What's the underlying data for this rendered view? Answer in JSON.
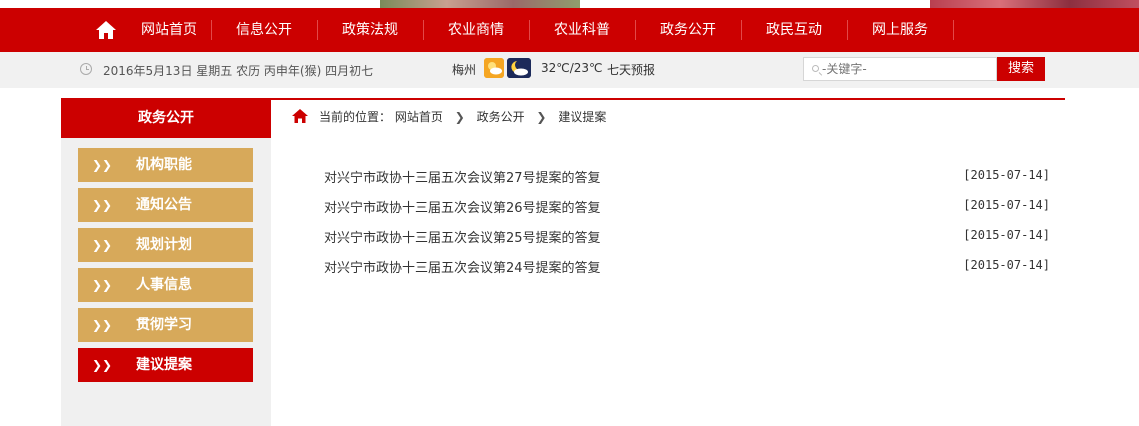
{
  "nav": {
    "home_icon": "home-icon",
    "items": [
      "网站首页",
      "信息公开",
      "政策法规",
      "农业商情",
      "农业科普",
      "政务公开",
      "政民互动",
      "网上服务"
    ]
  },
  "info": {
    "date": "2016年5月13日 星期五 农历 丙申年(猴) 四月初七",
    "city": "梅州",
    "temperature": "32℃/23℃",
    "forecast": "七天预报",
    "weather_icons": [
      "sun-cloud-icon",
      "moon-cloud-icon"
    ]
  },
  "search": {
    "placeholder": "-关键字-",
    "button": "搜索"
  },
  "sidebar": {
    "title": "政务公开",
    "arrow": "❯❯",
    "items": [
      "机构职能",
      "通知公告",
      "规划计划",
      "人事信息",
      "贯彻学习",
      "建议提案"
    ],
    "active_index": 5
  },
  "breadcrumb": {
    "prefix": "当前的位置：",
    "items": [
      "网站首页",
      "政务公开",
      "建议提案"
    ]
  },
  "articles": [
    {
      "title": "对兴宁市政协十三届五次会议第27号提案的答复",
      "date": "[2015-07-14]"
    },
    {
      "title": "对兴宁市政协十三届五次会议第26号提案的答复",
      "date": "[2015-07-14]"
    },
    {
      "title": "对兴宁市政协十三届五次会议第25号提案的答复",
      "date": "[2015-07-14]"
    },
    {
      "title": "对兴宁市政协十三届五次会议第24号提案的答复",
      "date": "[2015-07-14]"
    }
  ],
  "colors": {
    "brand_red": "#cc0000",
    "side_gold": "#d7a95a"
  }
}
